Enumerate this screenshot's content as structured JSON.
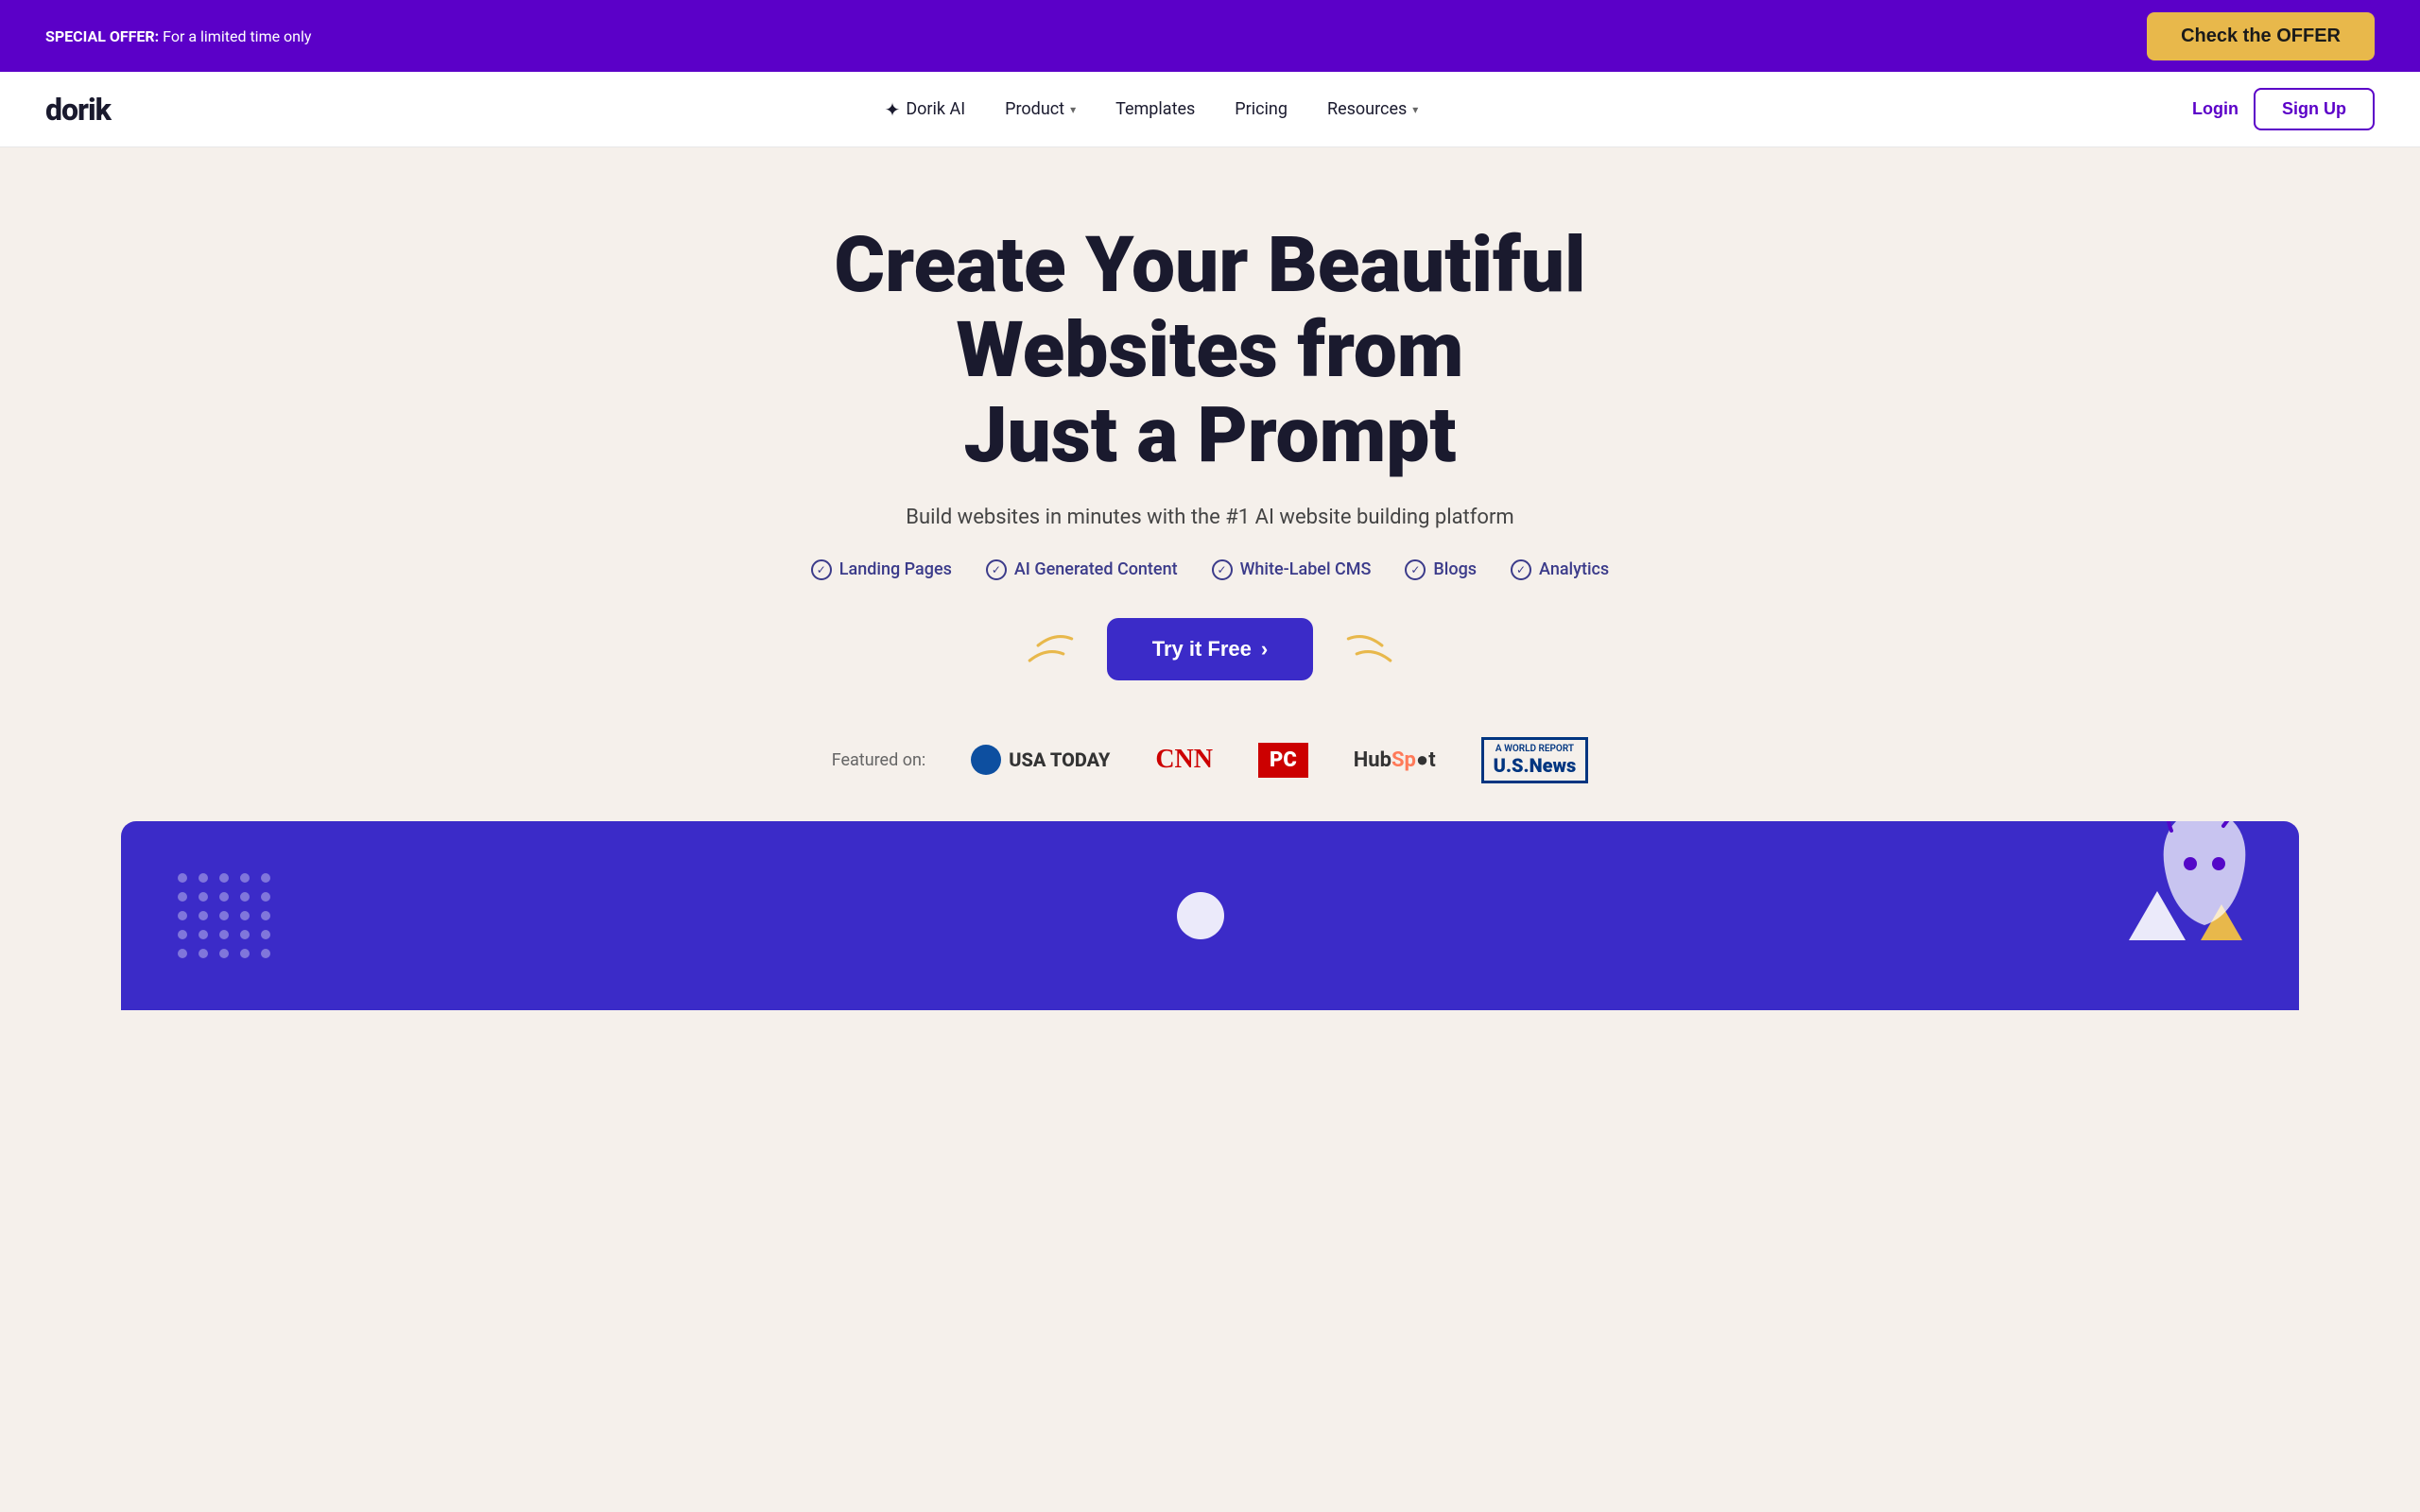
{
  "announcement": {
    "bold_text": "SPECIAL OFFER:",
    "normal_text": " For a limited time only",
    "cta_label": "Check the OFFER"
  },
  "navbar": {
    "logo_text": "dorik",
    "links": [
      {
        "id": "dorik-ai",
        "label": "Dorik AI",
        "has_icon": true,
        "has_chevron": false
      },
      {
        "id": "product",
        "label": "Product",
        "has_icon": false,
        "has_chevron": true
      },
      {
        "id": "templates",
        "label": "Templates",
        "has_icon": false,
        "has_chevron": false
      },
      {
        "id": "pricing",
        "label": "Pricing",
        "has_icon": false,
        "has_chevron": false
      },
      {
        "id": "resources",
        "label": "Resources",
        "has_icon": false,
        "has_chevron": true
      }
    ],
    "login_label": "Login",
    "signup_label": "Sign Up"
  },
  "hero": {
    "title_line1": "Create Your Beautiful Websites from",
    "title_line2": "Just a Prompt",
    "subtitle": "Build websites in minutes with the #1 AI website building platform",
    "features": [
      "Landing Pages",
      "AI Generated Content",
      "White-Label CMS",
      "Blogs",
      "Analytics"
    ],
    "cta_label": "Try it Free",
    "cta_arrow": "›"
  },
  "featured": {
    "label": "Featured on:",
    "logos": [
      {
        "id": "usa-today",
        "name": "USA TODAY"
      },
      {
        "id": "cnn",
        "name": "CNN"
      },
      {
        "id": "pc",
        "name": "PC"
      },
      {
        "id": "hubspot",
        "name": "HubSpot"
      },
      {
        "id": "usnews",
        "name": "U.S.News"
      }
    ]
  },
  "colors": {
    "purple": "#5b00c8",
    "dark_purple": "#3b2bc8",
    "navy": "#1a1a2e",
    "gold": "#e8b84b",
    "red": "#cc0000",
    "bg": "#f5f0eb"
  }
}
